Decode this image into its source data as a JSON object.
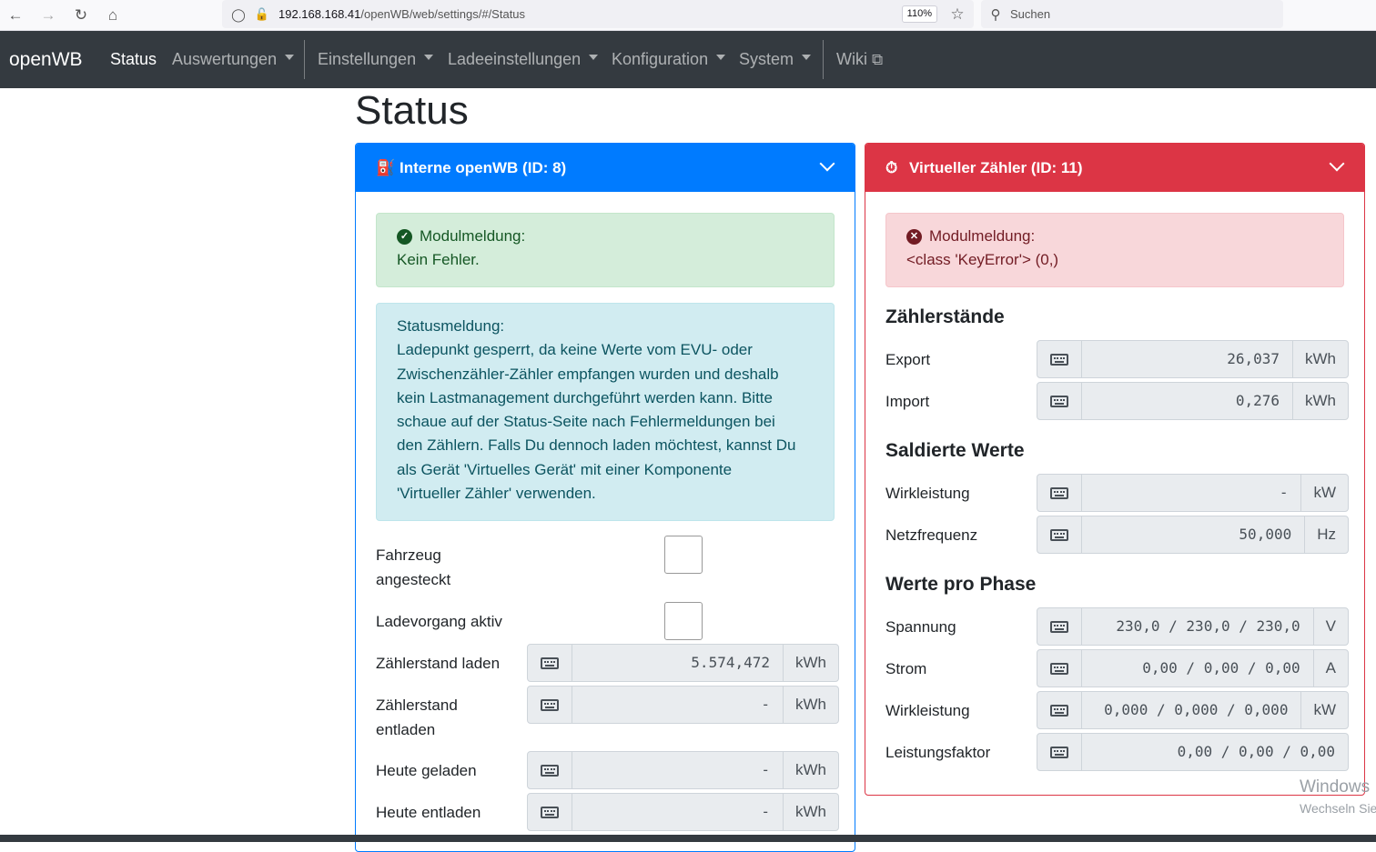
{
  "browser": {
    "url_host": "192.168.168.41",
    "url_path": "/openWB/web/settings/#/Status",
    "zoom": "110%",
    "search_placeholder": "Suchen"
  },
  "navbar": {
    "brand": "openWB",
    "items": [
      "Status",
      "Auswertungen",
      "Einstellungen",
      "Ladeeinstellungen",
      "Konfiguration",
      "System",
      "Wiki"
    ]
  },
  "page": {
    "title": "Status"
  },
  "card_left": {
    "header": "Interne openWB (ID: 8)",
    "module_label": "Modulmeldung:",
    "module_text": "Kein Fehler.",
    "status_label": "Statusmeldung:",
    "status_lines": [
      "Ladepunkt gesperrt, da keine Werte vom EVU- oder",
      "Zwischenzähler-Zähler empfangen wurden und deshalb",
      "kein Lastmanagement durchgeführt werden kann. Bitte",
      "schaue auf der Status-Seite nach Fehlermeldungen bei",
      "den Zählern. Falls Du dennoch laden möchtest, kannst Du",
      "als Gerät 'Virtuelles Gerät' mit einer Komponente",
      "'Virtueller Zähler' verwenden."
    ],
    "fahrzeug_line1": "Fahrzeug",
    "fahrzeug_line2": "angesteckt",
    "ladevorgang": "Ladevorgang aktiv",
    "rows": [
      {
        "label": "Zählerstand laden",
        "value": "5.574,472",
        "unit": "kWh"
      },
      {
        "label1": "Zählerstand",
        "label2": "entladen",
        "value": "-",
        "unit": "kWh"
      },
      {
        "label": "Heute geladen",
        "value": "-",
        "unit": "kWh"
      },
      {
        "label": "Heute entladen",
        "value": "-",
        "unit": "kWh"
      }
    ]
  },
  "card_right": {
    "header": "Virtueller Zähler (ID: 11)",
    "module_label": "Modulmeldung:",
    "module_text": "<class 'KeyError'> (0,)",
    "section1": "Zählerstände",
    "section2": "Saldierte Werte",
    "section3": "Werte pro Phase",
    "rows": [
      {
        "label": "Export",
        "value": "26,037",
        "unit": "kWh"
      },
      {
        "label": "Import",
        "value": "0,276",
        "unit": "kWh"
      },
      {
        "label": "Wirkleistung",
        "value": "-",
        "unit": "kW"
      },
      {
        "label": "Netzfrequenz",
        "value": "50,000",
        "unit": "Hz"
      },
      {
        "label": "Spannung",
        "value": "230,0 / 230,0 / 230,0",
        "unit": "V"
      },
      {
        "label": "Strom",
        "value": "0,00 / 0,00 / 0,00",
        "unit": "A"
      },
      {
        "label": "Wirkleistung",
        "value": "0,000 / 0,000 / 0,000",
        "unit": "kW"
      },
      {
        "label": "Leistungsfaktor",
        "value": "0,00 / 0,00 / 0,00",
        "unit": ""
      }
    ]
  },
  "watermark": {
    "line1": "Windows",
    "line2": "Wechseln Sie"
  },
  "colors": {
    "primary": "#007bff",
    "danger": "#dc3545",
    "navbar": "#343a40"
  }
}
